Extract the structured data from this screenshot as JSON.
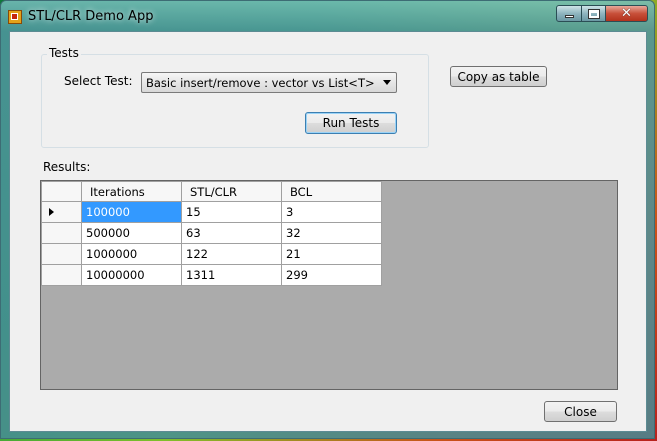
{
  "window": {
    "title": "STL/CLR Demo App",
    "caption_buttons": {
      "minimize": "minimize-icon",
      "maximize": "maximize-icon",
      "close": "close-icon"
    }
  },
  "tests_group": {
    "label": "Tests",
    "select_label": "Select Test:",
    "selected_test": "Basic insert/remove : vector vs List<T>",
    "run_button": "Run Tests"
  },
  "copy_button": "Copy as table",
  "results": {
    "label": "Results:",
    "columns": [
      "Iterations",
      "STL/CLR",
      "BCL"
    ],
    "rows": [
      [
        "100000",
        "15",
        "3"
      ],
      [
        "500000",
        "63",
        "32"
      ],
      [
        "1000000",
        "122",
        "21"
      ],
      [
        "10000000",
        "1311",
        "299"
      ]
    ]
  },
  "close_button": "Close",
  "colors": {
    "selection": "#3399ff",
    "grid_background": "#ababab"
  }
}
